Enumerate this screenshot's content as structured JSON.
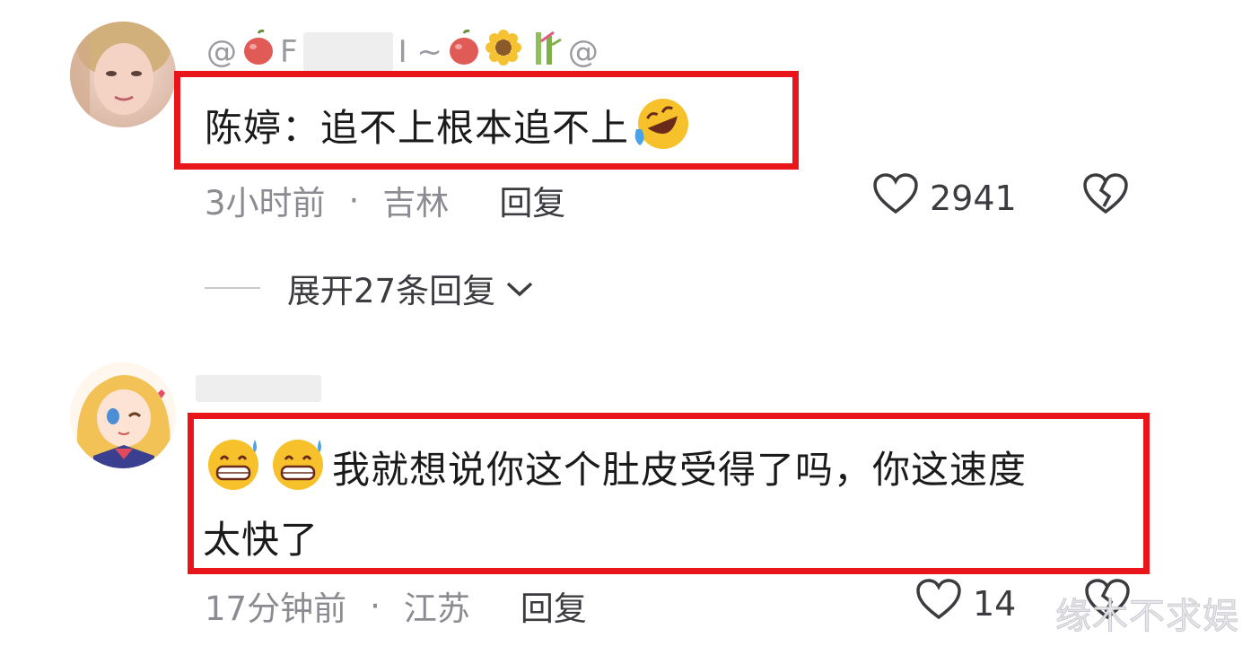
{
  "comments": [
    {
      "username_parts": [
        "@",
        "F",
        "I ~",
        "@"
      ],
      "text": "陈婷：追不上根本追不上",
      "time": "3小时前",
      "location": "吉林",
      "reply_label": "回复",
      "likes": "2941",
      "expand_label": "展开27条回复"
    },
    {
      "text_line1": "我就想说你这个肚皮受得了吗，你这速度",
      "text_line2": "太快了",
      "time": "17分钟前",
      "location": "江苏",
      "reply_label": "回复",
      "likes": "14"
    }
  ],
  "separator": "·",
  "watermark": "缘木不求娱",
  "colors": {
    "highlight": "#e8161b",
    "text": "#1a1a1a",
    "meta": "#8b8b91",
    "action": "#3b3b40"
  },
  "icons": [
    "avatar-woman",
    "apple-emoji",
    "sunflower-emoji",
    "bamboo-emoji",
    "rofl-emoji",
    "grin-sweat-emoji",
    "heart-icon",
    "broken-heart-icon",
    "chevron-down-icon"
  ]
}
